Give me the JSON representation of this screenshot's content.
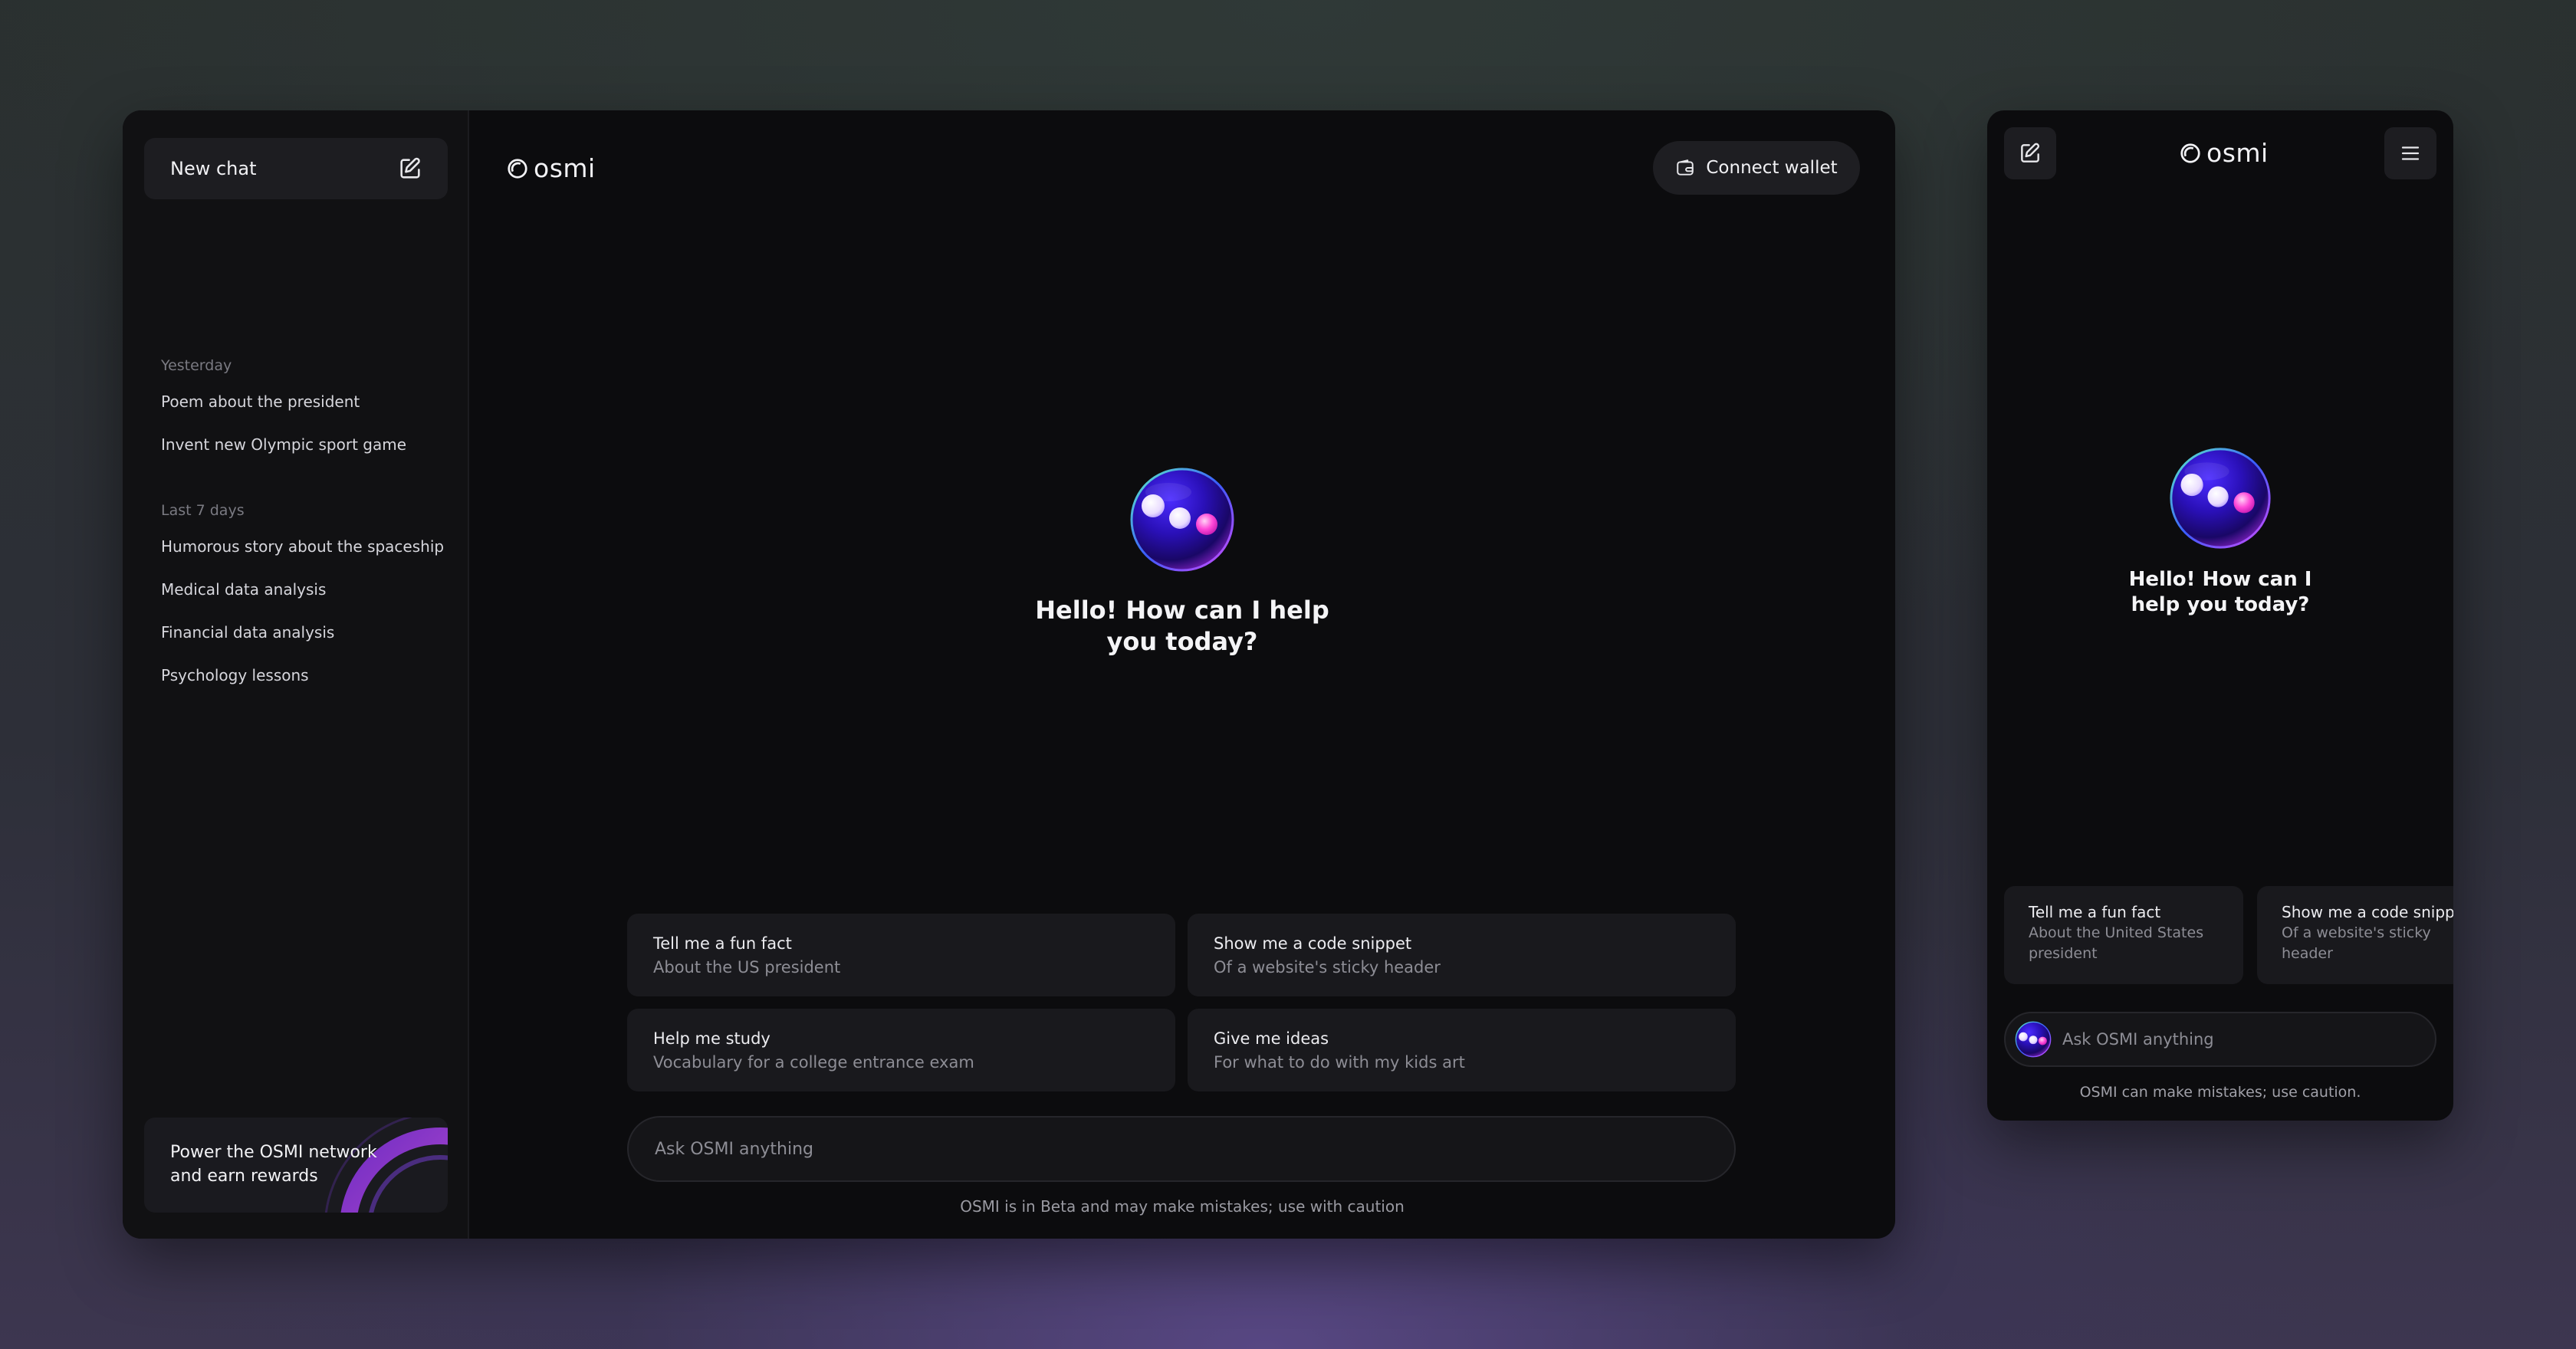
{
  "desktop": {
    "sidebar": {
      "new_chat_label": "New chat",
      "new_chat_icon": "compose-icon",
      "groups": [
        {
          "heading": "Yesterday",
          "items": [
            "Poem about the president",
            "Invent new Olympic sport game"
          ]
        },
        {
          "heading": "Last 7 days",
          "items": [
            "Humorous story about the spaceship",
            "Medical data analysis",
            "Financial data analysis",
            "Psychology lessons"
          ]
        }
      ],
      "promo_text": "Power the OSMI network and earn rewards"
    },
    "header": {
      "logo_text": "osmi",
      "connect_wallet_label": "Connect wallet",
      "connect_wallet_icon": "wallet-icon"
    },
    "greeting": "Hello! How can I help you today?",
    "suggestions": [
      {
        "title": "Tell me a fun fact",
        "subtitle": "About the US president"
      },
      {
        "title": "Show me a code snippet",
        "subtitle": "Of a website's sticky header"
      },
      {
        "title": "Help me study",
        "subtitle": "Vocabulary for a college entrance exam"
      },
      {
        "title": "Give me ideas",
        "subtitle": "For what to do with my kids art"
      }
    ],
    "input_placeholder": "Ask OSMI anything",
    "disclaimer": "OSMI is in Beta and may make mistakes; use with caution"
  },
  "mobile": {
    "logo_text": "osmi",
    "compose_icon": "compose-icon",
    "menu_icon": "hamburger-menu-icon",
    "greeting": "Hello! How can I help you today?",
    "suggestions": [
      {
        "title": "Tell me a fun fact",
        "subtitle": "About the United States president"
      },
      {
        "title": "Show me a code snippet",
        "subtitle": "Of a website's sticky header"
      }
    ],
    "input_placeholder": "Ask OSMI anything",
    "disclaimer": "OSMI can make mistakes; use caution."
  },
  "colors": {
    "background": "#0c0c0e",
    "sidebar": "#111113",
    "card": "#19191d",
    "orb_primary": "#3a12c8",
    "orb_accent": "#ff3fd0"
  }
}
